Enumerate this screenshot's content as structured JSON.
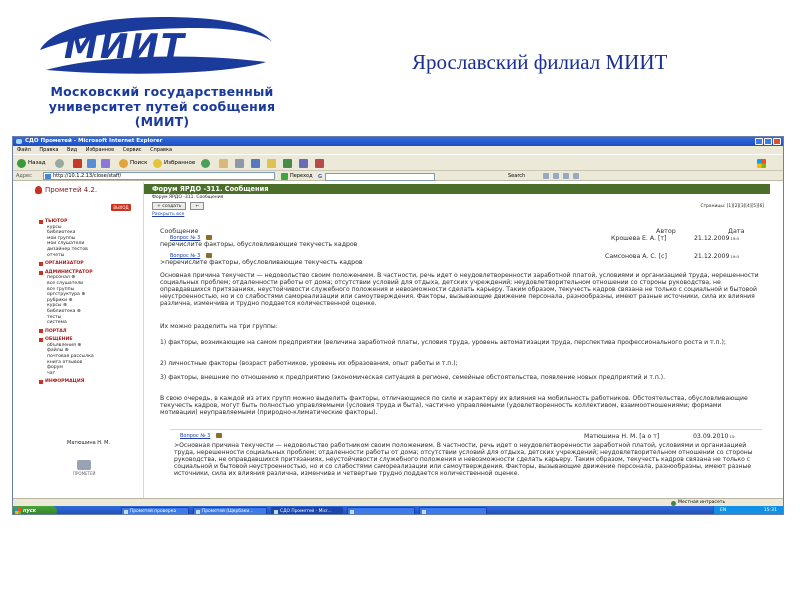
{
  "slide": {
    "title": "Ярославский филиал  МИИТ",
    "logo": {
      "brand": "МИИТ",
      "caption_lines": [
        "Московский государственный",
        "университет путей сообщения",
        "(МИИТ)"
      ],
      "color": "#1a3a9c"
    }
  },
  "browser": {
    "window_title": "СДО Прометей - Microsoft Internet Explorer",
    "menu": [
      "Файл",
      "Правка",
      "Вид",
      "Избранное",
      "Сервис",
      "Справка"
    ],
    "toolbar": {
      "back": "Назад",
      "search": "Поиск",
      "favorites": "Избранное"
    },
    "address_label": "Адрес",
    "address_value": "http://10.1.2.13/close/staff/",
    "go_label": "Переход",
    "google_search": "Search",
    "status_zone": "Местная интрасеть"
  },
  "sidebar": {
    "brand": "Прометей 4.2.",
    "logout": "ВЫХОД",
    "sections": [
      {
        "title": "ТЬЮТОР",
        "items": [
          "курсы",
          "библиотека",
          "мои группы",
          "мои слушатели",
          "дизайнер тестов",
          "отчеты"
        ]
      },
      {
        "title": "ОРГАНИЗАТОР",
        "items": []
      },
      {
        "title": "АДМИНИСТРАТОР",
        "items": [
          "персонал ⊕",
          "все слушатели",
          "все группы",
          "оргструктура ⊕",
          "рубрики ⊕",
          "курсы ⊕",
          "библиотека ⊕",
          "тесты",
          "система"
        ]
      },
      {
        "title": "ПОРТАЛ",
        "items": []
      },
      {
        "title": "ОБЩЕНИЕ",
        "items": [
          "объявления ⊕",
          "файлы ⊕",
          "почтовая рассылка",
          "книга отзывов",
          "форум",
          "чат"
        ]
      },
      {
        "title": "ИНФОРМАЦИЯ",
        "items": []
      }
    ],
    "user": "Матюшина Н. М.",
    "footer_logo": "ПРОМЕТЕЙ"
  },
  "forum": {
    "header": "Форум ЯРДО -311. Сообщения",
    "subheader": "Форум ЯРДО -311. Сообщения",
    "create_button": "+ создать",
    "back_button": "←",
    "expand_all": "Раскрыть все",
    "pages": "Страницы: [1][2][3][4][5][6]",
    "columns": {
      "message": "Сообщение",
      "author": "Автор",
      "date": "Дата"
    },
    "messages": [
      {
        "link": "Вопрос № 3",
        "body_line": "перечислите факторы, обусловливающие текучесть кадров",
        "author": "Крошева Е. А. [т]",
        "date": "21.12.2009",
        "time": "19:0"
      },
      {
        "link": "Вопрос № 3",
        "body_line": ">перечислите факторы, обусловливающие текучесть кадров",
        "author": "Самсонова А. С. [с]",
        "date": "21.12.2009",
        "time": "19:0",
        "paragraphs": [
          "Основная причина текучести — недовольство своим положением. В частности, речь идет о неудовлетворенности заработной платой, условиями и организацией труда, нерешенности социальных проблем; отдаленности работы от дома; отсутствии условий для отдыха, детских учреждений; неудовлетворительном отношении со стороны руководства, не оправдавшихся притязаниях, неустойчивости служебного положения и невозможности сделать карьеру. Таким образом, текучесть кадров связана не только с социальной и бытовой неустроенностью, но и со слабостями самореализации или самоутверждения. Факторы, вызывающие движение персонала, разнообразны, имеют разные источники, сила их влияния различна, изменчива и трудно поддается количественной оценке.",
          "Их можно разделить на три группы:",
          "1) факторы, возникающие на самом предприятии (величина заработной платы, условия труда, уровень автоматизации труда, перспектива профессионального роста и т.п.);",
          "2) личностные факторы (возраст работников, уровень их образования, опыт работы и т.п.);",
          "3) факторы, внешние по отношению к предприятию (экономическая ситуация в регионе, семейные обстоятельства, появление новых предприятий и т.п.).",
          "В свою очередь, в каждой из этих групп можно выделить факторы, отличающиеся по силе и характеру их влияния на мобильность работников. Обстоятельства, обусловливающие текучесть кадров, могут быть полностью управляемыми (условия труда и быта), частично управляемыми (удовлетворенность коллективом, взаимоотношениями; формами мотивации) неуправляемыми (природно-климатические факторы)."
        ]
      },
      {
        "link": "Вопрос № 3",
        "author": "Матюшина Н. М. [а о т]",
        "date": "03.09.2010",
        "time": "15:",
        "paragraphs": [
          ">Основная причина текучести — недовольство работником своим положением. В частности, речь идет о неудовлетворенности заработной платой, условиями и организацией труда, нерешенности социальных проблем; отдаленности работы от дома; отсутствии условий для отдыха, детских учреждений; неудовлетворительном отношении со стороны руководства, не оправдавшихся притязаниях, неустойчивости служебного положения и невозможности сделать карьеру. Таким образом, текучесть кадров связана не только с социальной и бытовой неустроенностью, но и со слабостями самореализации или самоутверждения. Факторы, вызывающие движение персонала, разнообразны, имеют разные источники, сила их влияния различна, изменчива и четвертые трудно поддается количественной оценке."
        ]
      }
    ]
  },
  "taskbar": {
    "start": "пуск",
    "tasks": [
      "Прометей проверка",
      "Прометей (Щербаки...",
      "СДО Прометей - Мicr...",
      "",
      ""
    ],
    "lang": "EN",
    "clock": "15:31"
  },
  "colors": {
    "forum_header_bg": "#4b6f2a",
    "sidebar_accent": "#c8321e",
    "title_blue": "#1a2f8f",
    "xp_taskbar": "#245edb"
  }
}
